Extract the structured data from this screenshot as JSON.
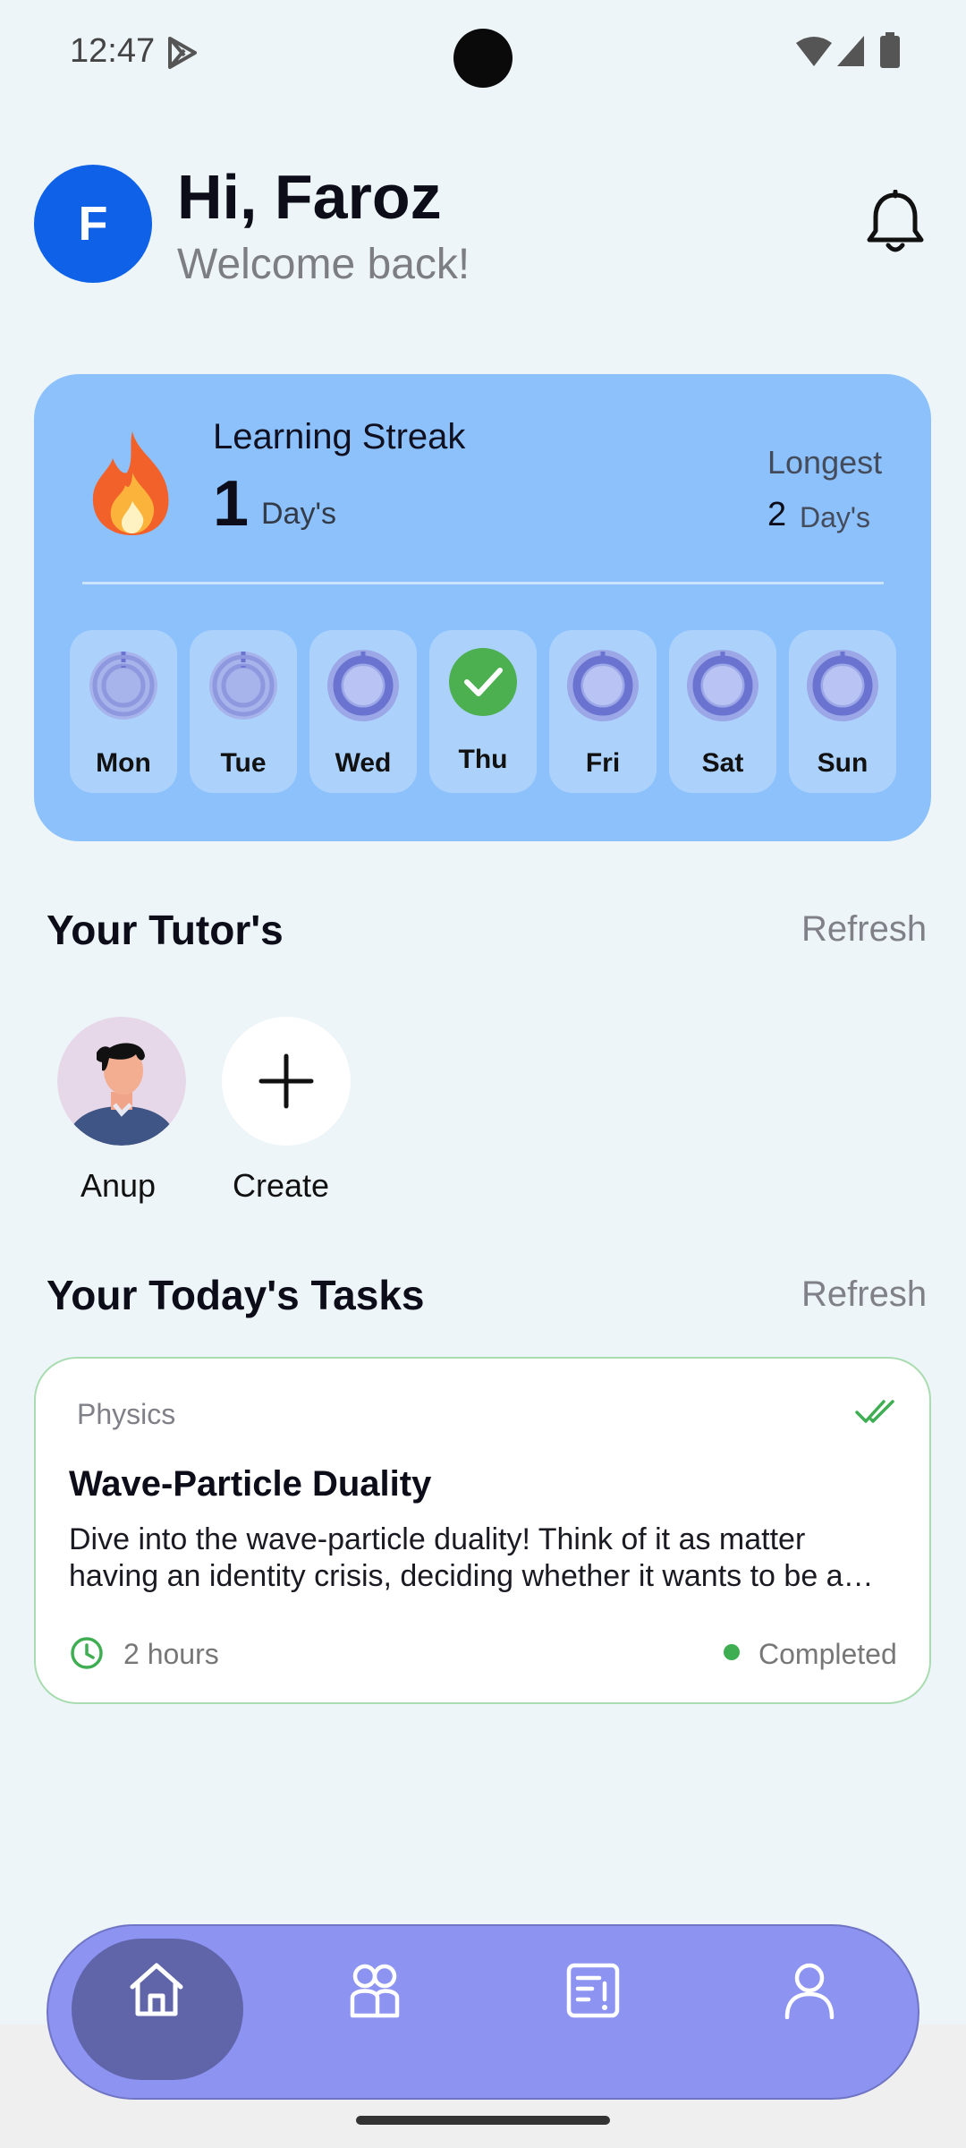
{
  "status_bar": {
    "time": "12:47"
  },
  "header": {
    "avatar_initial": "F",
    "greeting": "Hi, Faroz",
    "subtitle": "Welcome back!"
  },
  "streak": {
    "title": "Learning Streak",
    "current_value": "1",
    "current_unit": "Day's",
    "longest_label": "Longest",
    "longest_value": "2",
    "longest_unit": "Day's",
    "days": [
      {
        "label": "Mon",
        "state": "pending"
      },
      {
        "label": "Tue",
        "state": "pending"
      },
      {
        "label": "Wed",
        "state": "upcoming"
      },
      {
        "label": "Thu",
        "state": "done"
      },
      {
        "label": "Fri",
        "state": "upcoming"
      },
      {
        "label": "Sat",
        "state": "upcoming"
      },
      {
        "label": "Sun",
        "state": "upcoming"
      }
    ]
  },
  "tutors": {
    "title": "Your Tutor's",
    "refresh": "Refresh",
    "items": [
      {
        "label": "Anup"
      },
      {
        "label": "Create"
      }
    ]
  },
  "tasks": {
    "title": "Your Today's Tasks",
    "refresh": "Refresh",
    "items": [
      {
        "subject": "Physics",
        "title": "Wave-Particle Duality",
        "description": "Dive into the wave-particle duality! Think of it as matter having an identity crisis, deciding whether it wants to be a…",
        "duration": "2 hours",
        "status": "Completed"
      }
    ]
  },
  "colors": {
    "accent": "#0f62e8",
    "streak_card": "#8cc1fb",
    "nav": "#8d93f1",
    "nav_active": "#6064a9",
    "done_green": "#4caf50",
    "ring": "#6b73d1"
  },
  "nav": {
    "items": [
      "home-icon",
      "tutors-icon",
      "tasks-icon",
      "profile-icon"
    ],
    "active": "home-icon"
  }
}
